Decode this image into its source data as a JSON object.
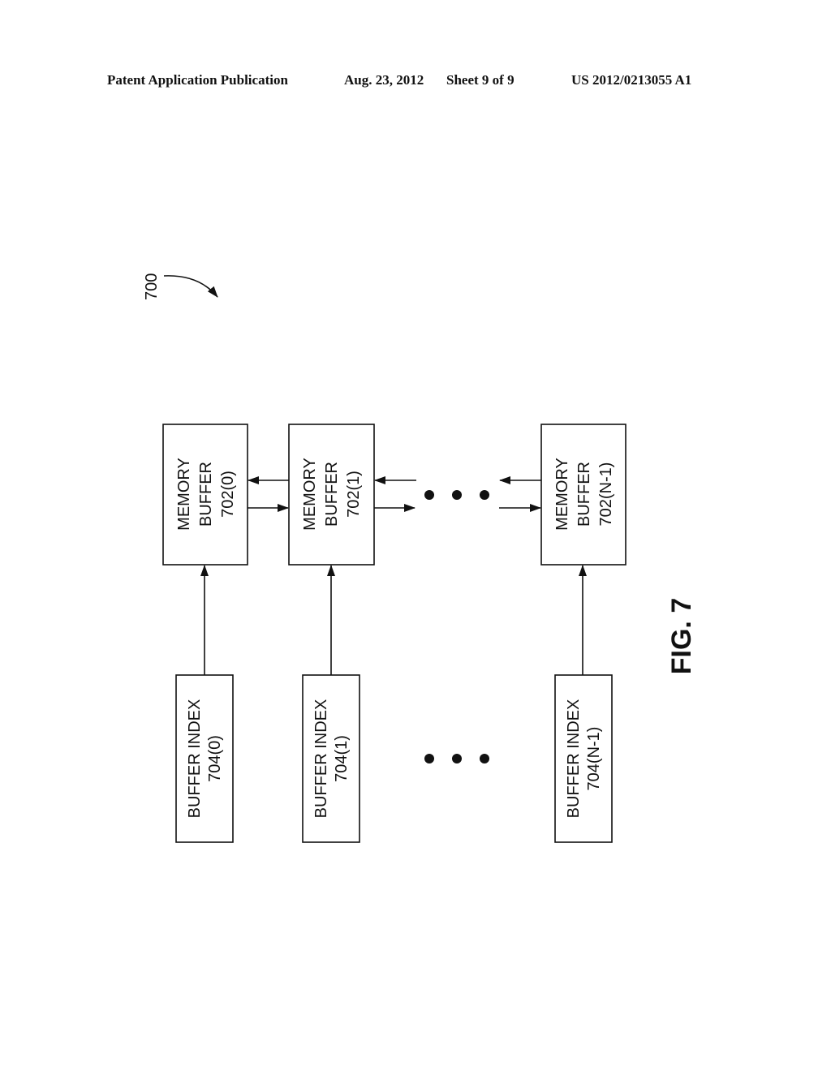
{
  "header": {
    "publication": "Patent Application Publication",
    "date": "Aug. 23, 2012",
    "sheet": "Sheet 9 of 9",
    "number": "US 2012/0213055 A1"
  },
  "figure": {
    "reference": "700",
    "caption": "FIG. 7",
    "memory_buffers": [
      {
        "line1": "MEMORY",
        "line2": "BUFFER",
        "line3": "702(0)"
      },
      {
        "line1": "MEMORY",
        "line2": "BUFFER",
        "line3": "702(1)"
      },
      {
        "line1": "MEMORY",
        "line2": "BUFFER",
        "line3": "702(N-1)"
      }
    ],
    "buffer_indexes": [
      {
        "line1": "BUFFER INDEX",
        "line2": "704(0)"
      },
      {
        "line1": "BUFFER INDEX",
        "line2": "704(1)"
      },
      {
        "line1": "BUFFER INDEX",
        "line2": "704(N-1)"
      }
    ],
    "ellipsis": "• • •"
  }
}
